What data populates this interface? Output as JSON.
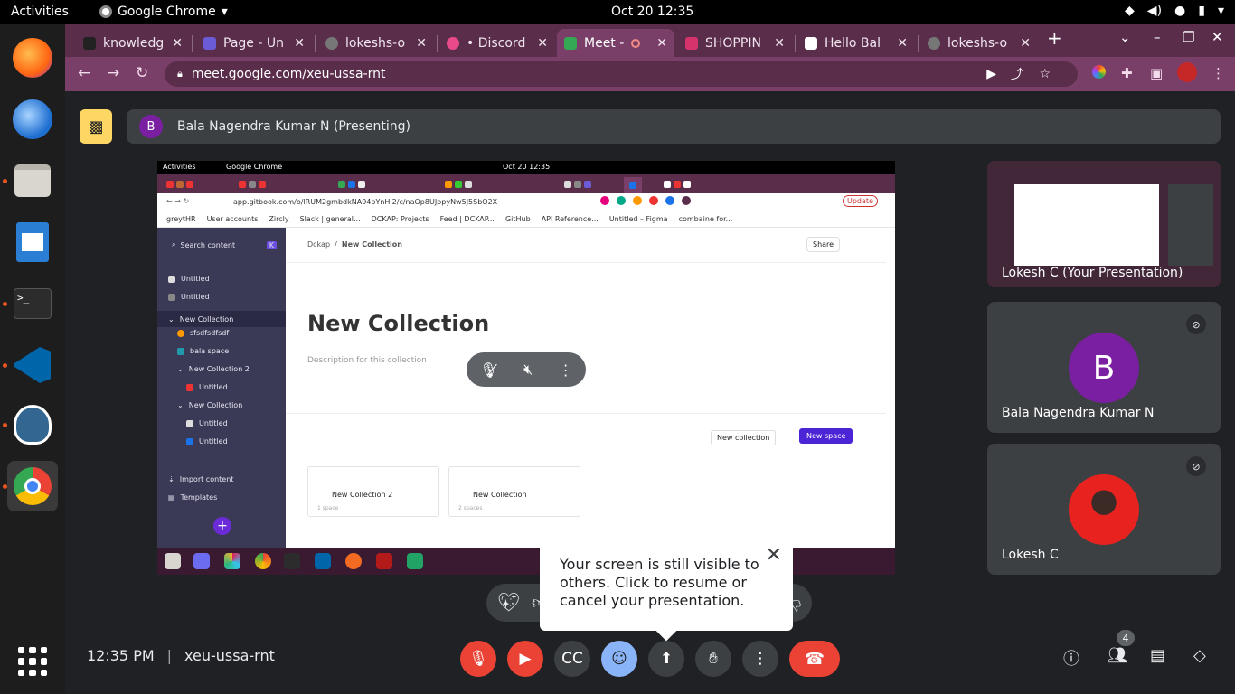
{
  "gnome": {
    "activities": "Activities",
    "app_name": "Google Chrome",
    "clock": "Oct 20  12:35"
  },
  "tabs": [
    {
      "label": "knowledg",
      "color": "#222"
    },
    {
      "label": "Page - Un",
      "color": "#6b5bd6"
    },
    {
      "label": "lokeshs-o",
      "color": "#777"
    },
    {
      "label": "• Discord",
      "color": "#e94a8a"
    },
    {
      "label": "Meet -",
      "color": "#34a853"
    },
    {
      "label": "SHOPPIN",
      "color": "#d6336c"
    },
    {
      "label": "Hello Bal",
      "color": "#ffffff"
    },
    {
      "label": "lokeshs-o",
      "color": "#777"
    }
  ],
  "omnibox": {
    "url": "meet.google.com/xeu-ussa-rnt"
  },
  "meet": {
    "presenting_avatar": "B",
    "presenting_label": "Bala Nagendra Kumar N (Presenting)",
    "meeting_time": "12:35 PM",
    "meeting_code": "xeu-ussa-rnt",
    "participant_count": "4"
  },
  "shared_screen": {
    "top_activities": "Activities",
    "top_app": "Google Chrome",
    "top_clock": "Oct 20  12:35",
    "url": "app.gitbook.com/o/lRUM2gmbdkNA94pYnHl2/c/naOp8UJppyNw5J5SbQ2X",
    "update": "Update",
    "bookmarks": [
      "greytHR",
      "User accounts",
      "Zircly",
      "Slack | general...",
      "DCKAP: Projects",
      "Feed | DCKAP...",
      "GitHub",
      "API Reference...",
      "Untitled – Figma",
      "combaine for..."
    ],
    "search_placeholder": "Search content",
    "sidebar_items": [
      {
        "label": "Untitled",
        "indent": 0
      },
      {
        "label": "Untitled",
        "indent": 0
      },
      {
        "label": "New Collection",
        "indent": 0
      },
      {
        "label": "sfsdfsdfsdf",
        "indent": 1
      },
      {
        "label": "bala space",
        "indent": 1
      },
      {
        "label": "New Collection 2",
        "indent": 1
      },
      {
        "label": "Untitled",
        "indent": 2
      },
      {
        "label": "New Collection",
        "indent": 1
      },
      {
        "label": "Untitled",
        "indent": 2
      },
      {
        "label": "Untitled",
        "indent": 2
      }
    ],
    "import_content": "Import content",
    "templates": "Templates",
    "breadcrumb_root": "Dckap",
    "breadcrumb_current": "New Collection",
    "share": "Share",
    "page_title": "New Collection",
    "description": "Description for this collection",
    "new_collection_btn": "New collection",
    "new_space_btn": "New space",
    "cards": [
      {
        "title": "New Collection 2",
        "sub": "1 space"
      },
      {
        "title": "New Collection",
        "sub": "2 spaces"
      }
    ]
  },
  "tiles": [
    {
      "name": "Lokesh C (Your Presentation)",
      "avatar": ""
    },
    {
      "name": "Bala Nagendra Kumar N",
      "avatar": "B",
      "avatar_color": "#7b1fa2"
    },
    {
      "name": "Lokesh C",
      "avatar": "",
      "avatar_color": "#e8231f"
    }
  ],
  "popup": {
    "text": "Your screen is still visible to others. Click to resume or cancel your presentation."
  },
  "colors": {
    "chrome_frame": "#5a2d4b",
    "chrome_active": "#7a3f68",
    "meet_bg": "#202124",
    "danger": "#ea4335",
    "presenting_warning": "#fdd663"
  }
}
